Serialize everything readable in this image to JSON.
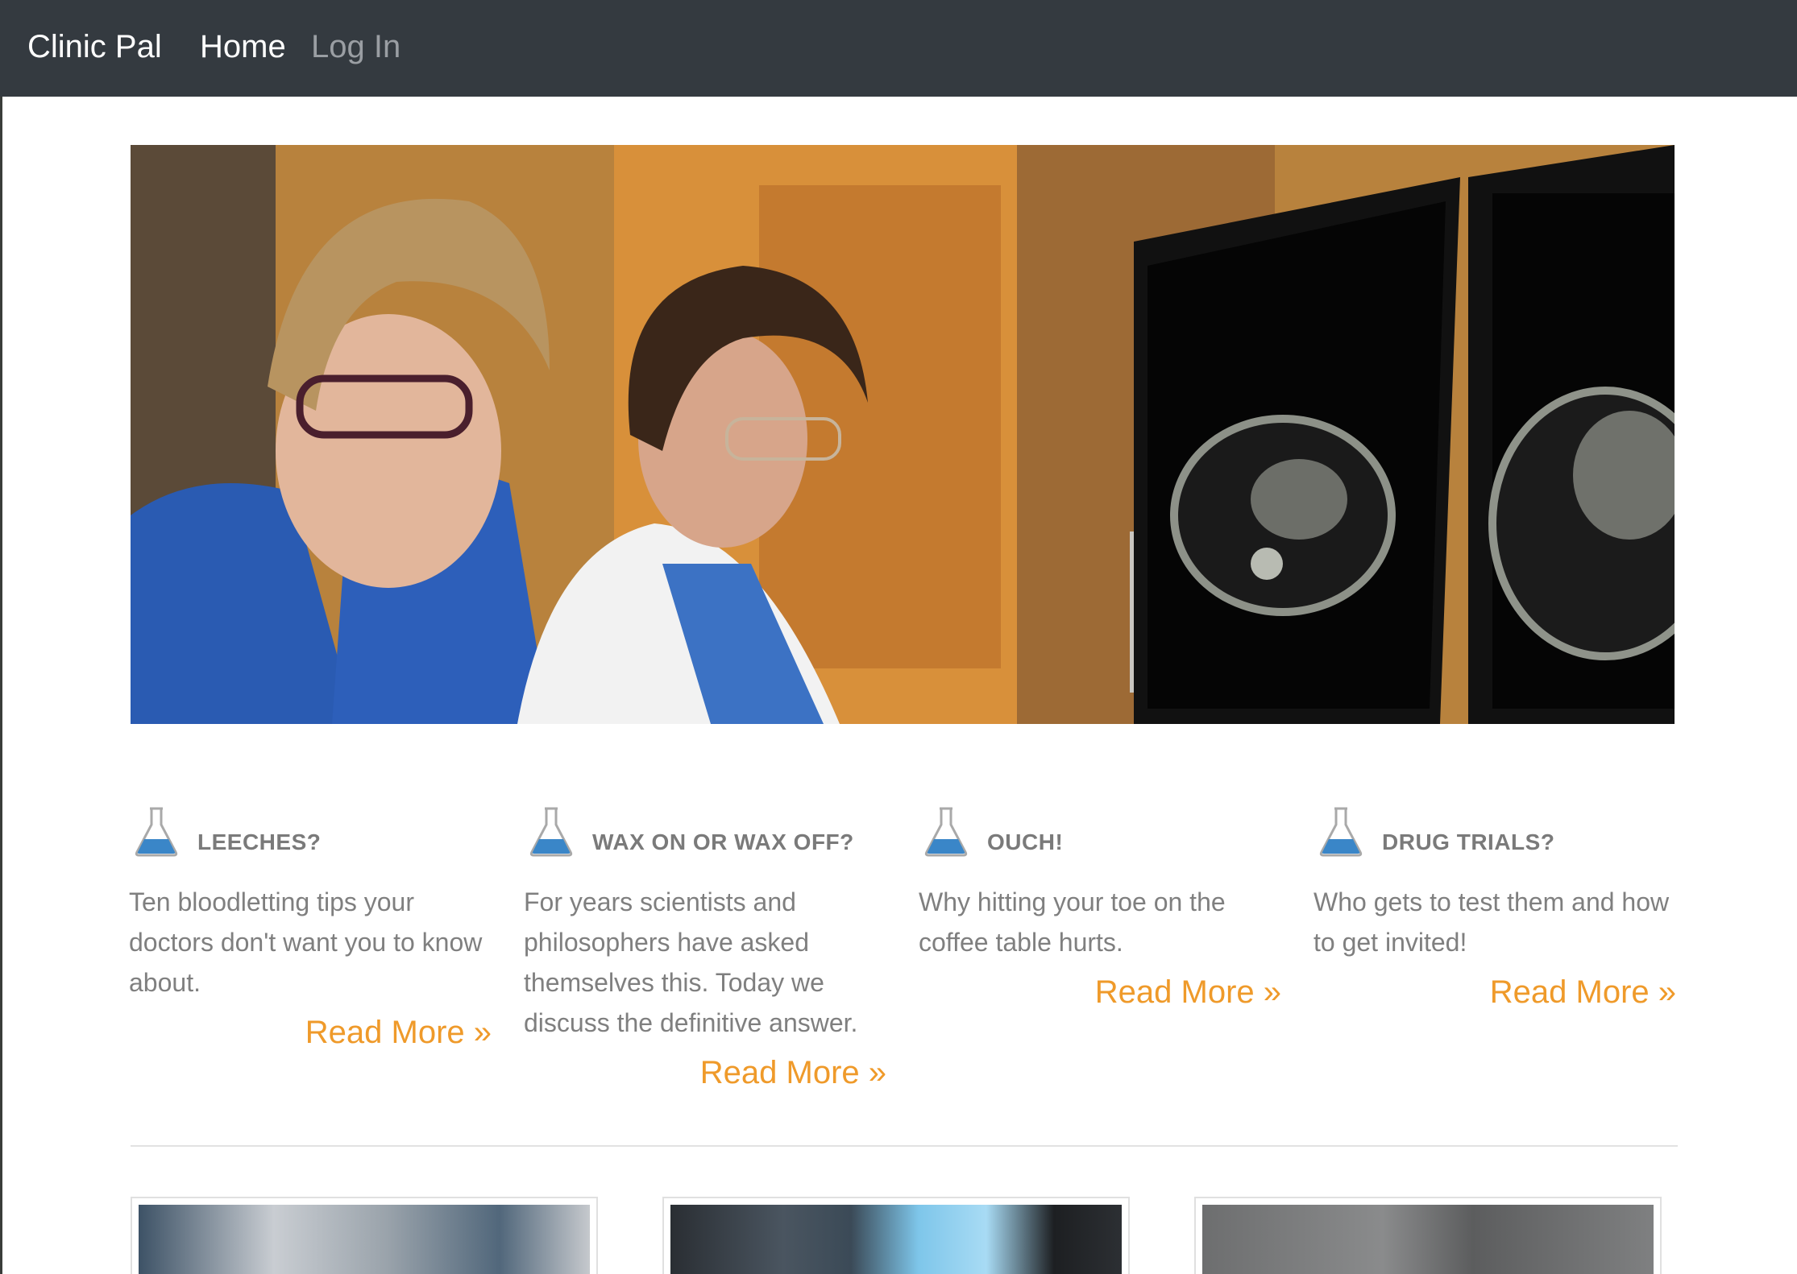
{
  "navbar": {
    "brand": "Clinic Pal",
    "links": [
      {
        "label": "Home",
        "active": true
      },
      {
        "label": "Log In",
        "active": false
      }
    ],
    "background": "#343a40"
  },
  "features": [
    {
      "icon": "flask-icon",
      "title": "LEECHES?",
      "text": "Ten bloodletting tips your doctors don't want you to know about.",
      "link": "Read More »"
    },
    {
      "icon": "flask-icon",
      "title": "WAX ON OR WAX OFF?",
      "text": "For years scientists and philosophers have asked themselves this. Today we discuss the definitive answer.",
      "link": "Read More »"
    },
    {
      "icon": "flask-icon",
      "title": "OUCH!",
      "text": "Why hitting your toe on the coffee table hurts.",
      "link": "Read More »"
    },
    {
      "icon": "flask-icon",
      "title": "DRUG TRIALS?",
      "text": "Who gets to test them and how to get invited!",
      "link": "Read More »"
    }
  ],
  "colors": {
    "accent": "#ef9a2a",
    "text": "#7f7f7f",
    "flask": "#3a86c8"
  }
}
